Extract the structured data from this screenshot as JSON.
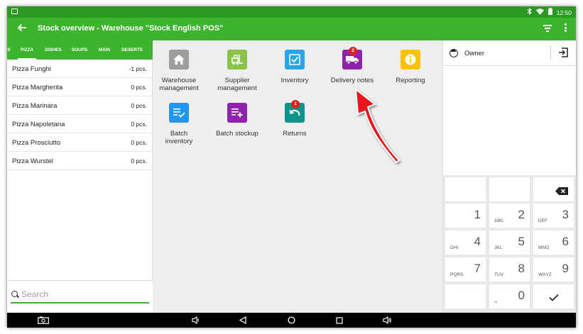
{
  "status_bar": {
    "time": "12:50"
  },
  "app_bar": {
    "title": "Stock overview - Warehouse \"Stock English POS\""
  },
  "categories": [
    {
      "label": "S",
      "active": false
    },
    {
      "label": "PIZZA",
      "active": true
    },
    {
      "label": "DISHES",
      "active": false
    },
    {
      "label": "SOUPS",
      "active": false
    },
    {
      "label": "MAIN",
      "active": false
    },
    {
      "label": "DESERTS",
      "active": false
    }
  ],
  "products": [
    {
      "name": "Pizza Funghi",
      "qty": "-1 pcs."
    },
    {
      "name": "Pizza Margherita",
      "qty": "0 pcs."
    },
    {
      "name": "Pizza Marinara",
      "qty": "0 pcs."
    },
    {
      "name": "Pizza Napoletana",
      "qty": "0 pcs."
    },
    {
      "name": "Pizza Prosciutto",
      "qty": "0 pcs."
    },
    {
      "name": "Pizza Wurstel",
      "qty": "0 pcs."
    }
  ],
  "search": {
    "placeholder": "Search"
  },
  "menu": [
    {
      "label": "Warehouse management",
      "icon": "home-icon",
      "color": "#9e9e9e"
    },
    {
      "label": "Supplier management",
      "icon": "forklift-icon",
      "color": "#8bc34a"
    },
    {
      "label": "Inventory",
      "icon": "checkbox-icon",
      "color": "#29a6e6"
    },
    {
      "label": "Delivery notes",
      "icon": "truck-icon",
      "color": "#8e24aa",
      "badge": "2"
    },
    {
      "label": "Reporting",
      "icon": "info-icon",
      "color": "#ffc107"
    },
    {
      "label": "Batch inventory",
      "icon": "list-check-icon",
      "color": "#2196f3"
    },
    {
      "label": "Batch stockup",
      "icon": "list-add-icon",
      "color": "#8e24aa"
    },
    {
      "label": "Returns",
      "icon": "undo-icon",
      "color": "#0d9488",
      "badge": "1"
    }
  ],
  "owner": {
    "name": "Owner"
  },
  "keypad": {
    "keys": [
      {
        "num": "",
        "letters": ""
      },
      {
        "num": "",
        "letters": ""
      },
      {
        "num": "",
        "letters": "",
        "icon": "backspace-icon"
      },
      {
        "num": "1",
        "letters": ""
      },
      {
        "num": "2",
        "letters": "ABC"
      },
      {
        "num": "3",
        "letters": "DEF"
      },
      {
        "num": "4",
        "letters": "GHI"
      },
      {
        "num": "5",
        "letters": "JKL"
      },
      {
        "num": "6",
        "letters": "MNO"
      },
      {
        "num": "7",
        "letters": "PQRS"
      },
      {
        "num": "8",
        "letters": "TUV"
      },
      {
        "num": "9",
        "letters": "WXYZ"
      },
      {
        "num": "",
        "letters": ""
      },
      {
        "num": "0",
        "letters": "␣"
      },
      {
        "num": "",
        "letters": "",
        "icon": "check-icon"
      }
    ]
  },
  "colors": {
    "brand": "#3db42d",
    "status_bar": "#2a9a22",
    "arrow": "#e8141c",
    "badge": "#e02020"
  }
}
